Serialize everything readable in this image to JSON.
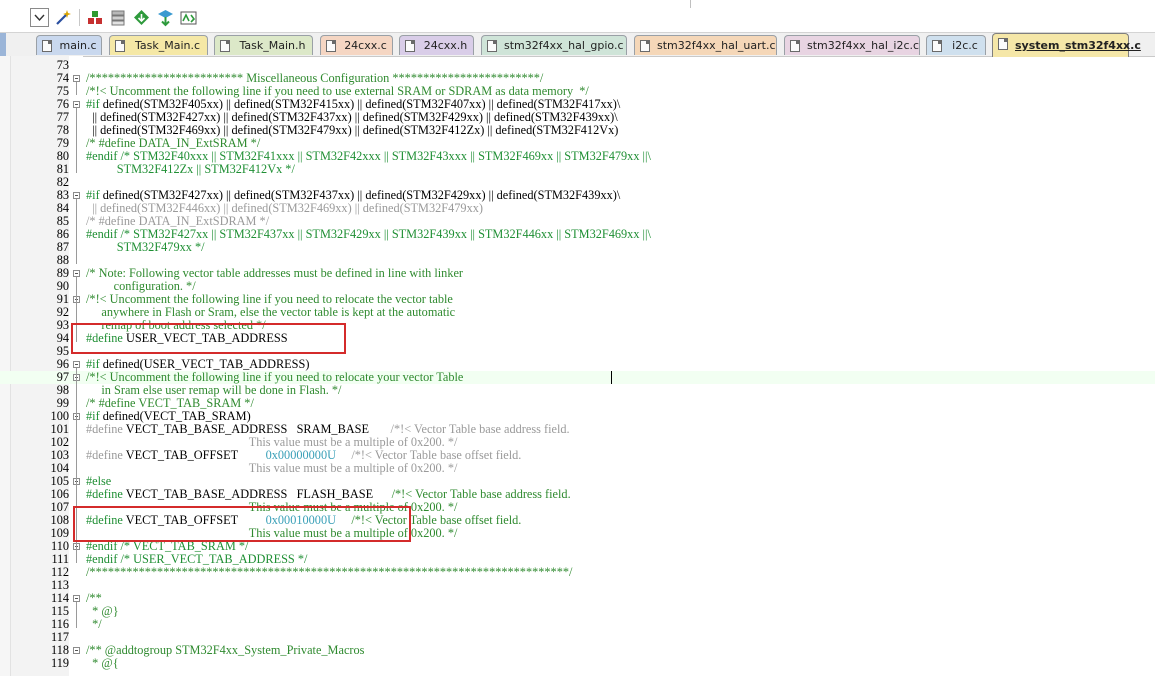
{
  "tabs": [
    {
      "label": "main.c",
      "color": "#c9d8ee",
      "active": false
    },
    {
      "label": "Task_Main.c",
      "color": "#f5e8a6",
      "active": false
    },
    {
      "label": "Task_Main.h",
      "color": "#dce8c8",
      "active": false
    },
    {
      "label": "24cxx.c",
      "color": "#f5d6c3",
      "active": false
    },
    {
      "label": "24cxx.h",
      "color": "#d9cde8",
      "active": false
    },
    {
      "label": "stm32f4xx_hal_gpio.c",
      "color": "#cfe4d8",
      "active": false
    },
    {
      "label": "stm32f4xx_hal_uart.c",
      "color": "#f5d7b8",
      "active": false
    },
    {
      "label": "stm32f4xx_hal_i2c.c",
      "color": "#e8d4e2",
      "active": false
    },
    {
      "label": "i2c.c",
      "color": "#cfe0ee",
      "active": false
    },
    {
      "label": "system_stm32f4xx.c",
      "color": "#f5e7a8",
      "active": true
    }
  ],
  "toolbar": [
    "dropdown-arrow-icon",
    "magic-wand-icon",
    "build-target-icon",
    "stack-icon",
    "diamond-download-icon",
    "flash-download-icon",
    "translate-icon"
  ],
  "lines": [
    {
      "n": "73",
      "segs": []
    },
    {
      "n": "74",
      "segs": [
        [
          "c",
          "/************************* Miscellaneous Configuration ************************/"
        ]
      ]
    },
    {
      "n": "75",
      "segs": [
        [
          "c",
          "/*!< Uncomment the following line if you need to use external SRAM or SDRAM as data memory  */"
        ]
      ]
    },
    {
      "n": "76",
      "segs": [
        [
          "p",
          "#if"
        ],
        [
          "n",
          " defined(STM32F405xx) || defined(STM32F415xx) || defined(STM32F407xx) || defined(STM32F417xx)\\"
        ]
      ]
    },
    {
      "n": "77",
      "segs": [
        [
          "n",
          "  || defined(STM32F427xx) || defined(STM32F437xx) || defined(STM32F429xx) || defined(STM32F439xx)\\"
        ]
      ]
    },
    {
      "n": "78",
      "segs": [
        [
          "n",
          "  || defined(STM32F469xx) || defined(STM32F479xx) || defined(STM32F412Zx) || defined(STM32F412Vx)"
        ]
      ]
    },
    {
      "n": "79",
      "segs": [
        [
          "c",
          "/* #define DATA_IN_ExtSRAM */"
        ]
      ]
    },
    {
      "n": "80",
      "segs": [
        [
          "p",
          "#endif /* STM32F40xxx || STM32F41xxx || STM32F42xxx || STM32F43xxx || STM32F469xx || STM32F479xx ||\\"
        ]
      ]
    },
    {
      "n": "81",
      "segs": [
        [
          "p",
          "          STM32F412Zx || STM32F412Vx */"
        ]
      ]
    },
    {
      "n": "82",
      "segs": []
    },
    {
      "n": "83",
      "segs": [
        [
          "p",
          "#if"
        ],
        [
          "n",
          " defined(STM32F427xx) || defined(STM32F437xx) || defined(STM32F429xx) || defined(STM32F439xx)\\"
        ]
      ]
    },
    {
      "n": "84",
      "segs": [
        [
          "g",
          "  || defined(STM32F446xx) || defined(STM32F469xx) || defined(STM32F479xx)"
        ]
      ]
    },
    {
      "n": "85",
      "segs": [
        [
          "g",
          "/* #define DATA_IN_ExtSDRAM */"
        ]
      ]
    },
    {
      "n": "86",
      "segs": [
        [
          "p",
          "#endif /* STM32F427xx || STM32F437xx || STM32F429xx || STM32F439xx || STM32F446xx || STM32F469xx ||\\"
        ]
      ]
    },
    {
      "n": "87",
      "segs": [
        [
          "p",
          "          STM32F479xx */"
        ]
      ]
    },
    {
      "n": "88",
      "segs": []
    },
    {
      "n": "89",
      "segs": [
        [
          "c",
          "/* Note: Following vector table addresses must be defined in line with linker"
        ]
      ]
    },
    {
      "n": "90",
      "segs": [
        [
          "c",
          "         configuration. */"
        ]
      ]
    },
    {
      "n": "91",
      "segs": [
        [
          "c",
          "/*!< Uncomment the following line if you need to relocate the vector table"
        ]
      ]
    },
    {
      "n": "92",
      "segs": [
        [
          "c",
          "     anywhere in Flash or Sram, else the vector table is kept at the automatic"
        ]
      ]
    },
    {
      "n": "93",
      "segs": [
        [
          "c",
          "     remap of boot address selected */"
        ]
      ]
    },
    {
      "n": "94",
      "segs": [
        [
          "p",
          "#define"
        ],
        [
          "n",
          " USER_VECT_TAB_ADDRESS"
        ]
      ]
    },
    {
      "n": "95",
      "segs": []
    },
    {
      "n": "96",
      "segs": [
        [
          "p",
          "#if"
        ],
        [
          "n",
          " defined(USER_VECT_TAB_ADDRESS)"
        ]
      ]
    },
    {
      "n": "97",
      "segs": [
        [
          "c",
          "/*!< Uncomment the following line if you need to relocate your vector Table"
        ]
      ],
      "hl": true
    },
    {
      "n": "98",
      "segs": [
        [
          "c",
          "     in Sram else user remap will be done in Flash. */"
        ]
      ]
    },
    {
      "n": "99",
      "segs": [
        [
          "c",
          "/* #define VECT_TAB_SRAM */"
        ]
      ]
    },
    {
      "n": "100",
      "segs": [
        [
          "p",
          "#if"
        ],
        [
          "n",
          " defined(VECT_TAB_SRAM)"
        ]
      ]
    },
    {
      "n": "101",
      "segs": [
        [
          "g",
          "#define"
        ],
        [
          "n",
          " VECT_TAB_BASE_ADDRESS   SRAM_BASE       "
        ],
        [
          "g",
          "/*!< Vector Table base address field."
        ]
      ]
    },
    {
      "n": "102",
      "segs": [
        [
          "g",
          "                                                     This value must be a multiple of 0x200. */"
        ]
      ]
    },
    {
      "n": "103",
      "segs": [
        [
          "g",
          "#define"
        ],
        [
          "n",
          " VECT_TAB_OFFSET         "
        ],
        [
          "v",
          "0x00000000U"
        ],
        [
          "n",
          "     "
        ],
        [
          "g",
          "/*!< Vector Table base offset field."
        ]
      ]
    },
    {
      "n": "104",
      "segs": [
        [
          "g",
          "                                                     This value must be a multiple of 0x200. */"
        ]
      ]
    },
    {
      "n": "105",
      "segs": [
        [
          "p",
          "#else"
        ]
      ]
    },
    {
      "n": "106",
      "segs": [
        [
          "p",
          "#define"
        ],
        [
          "n",
          " VECT_TAB_BASE_ADDRESS   FLASH_BASE      "
        ],
        [
          "c",
          "/*!< Vector Table base address field."
        ]
      ]
    },
    {
      "n": "107",
      "segs": [
        [
          "c",
          "                                                     This value must be a multiple of 0x200. */"
        ]
      ]
    },
    {
      "n": "108",
      "segs": [
        [
          "p",
          "#define"
        ],
        [
          "n",
          " VECT_TAB_OFFSET         "
        ],
        [
          "v",
          "0x00010000U"
        ],
        [
          "n",
          "     "
        ],
        [
          "c",
          "/*!< Vector Table base offset field."
        ]
      ]
    },
    {
      "n": "109",
      "segs": [
        [
          "c",
          "                                                     This value must be a multiple of 0x200. */"
        ]
      ]
    },
    {
      "n": "110",
      "segs": [
        [
          "p",
          "#endif /* VECT_TAB_SRAM */"
        ]
      ]
    },
    {
      "n": "111",
      "segs": [
        [
          "p",
          "#endif /* USER_VECT_TAB_ADDRESS */"
        ]
      ]
    },
    {
      "n": "112",
      "segs": [
        [
          "c",
          "/******************************************************************************/"
        ]
      ]
    },
    {
      "n": "113",
      "segs": []
    },
    {
      "n": "114",
      "segs": [
        [
          "c",
          "/**"
        ]
      ]
    },
    {
      "n": "115",
      "segs": [
        [
          "c",
          "  * @}"
        ]
      ]
    },
    {
      "n": "116",
      "segs": [
        [
          "c",
          "  */"
        ]
      ]
    },
    {
      "n": "117",
      "segs": []
    },
    {
      "n": "118",
      "segs": [
        [
          "c",
          "/** @addtogroup STM32F4xx_System_Private_Macros"
        ]
      ]
    },
    {
      "n": "119",
      "segs": [
        [
          "c",
          "  * @{"
        ]
      ]
    }
  ]
}
